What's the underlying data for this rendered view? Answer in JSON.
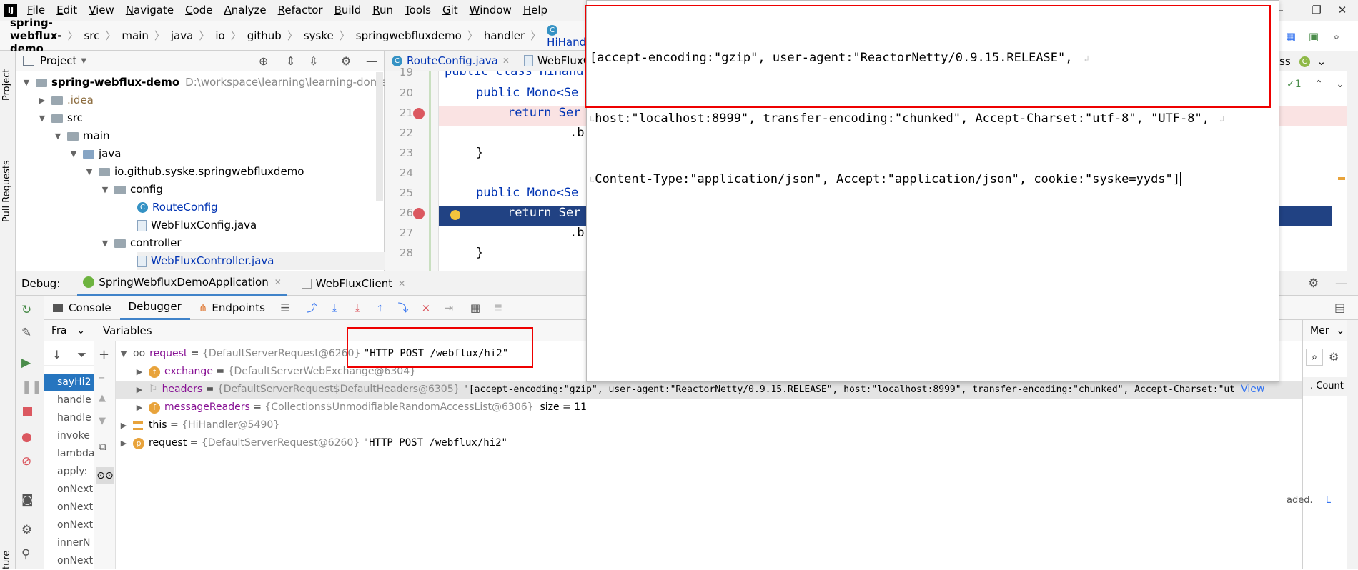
{
  "menu": [
    "File",
    "Edit",
    "View",
    "Navigate",
    "Code",
    "Analyze",
    "Refactor",
    "Build",
    "Run",
    "Tools",
    "Git",
    "Window",
    "Help"
  ],
  "breadcrumbs": [
    "spring-webflux-demo",
    "src",
    "main",
    "java",
    "io",
    "github",
    "syske",
    "springwebfluxdemo",
    "handler",
    "HiHandle"
  ],
  "left_strip": {
    "project": "Project",
    "pull_requests": "Pull Requests",
    "structure": "ture"
  },
  "project": {
    "title": "Project",
    "root_name": "spring-webflux-demo",
    "root_path": "D:\\workspace\\learning\\learning-dome-co",
    "items": [
      ".idea",
      "src",
      "main",
      "java",
      "io.github.syske.springwebfluxdemo",
      "config",
      "RouteConfig",
      "WebFluxConfig.java",
      "controller",
      "WebFluxController.java"
    ]
  },
  "editor": {
    "tabs": [
      "RouteConfig.java",
      "WebFluxC",
      "ss"
    ],
    "top_partial": "public class HiHand",
    "lines": [
      {
        "num": "20",
        "text": "public Mono<Se"
      },
      {
        "num": "21",
        "text": "return Ser"
      },
      {
        "num": "22",
        "text": ".b"
      },
      {
        "num": "23",
        "text": "}"
      },
      {
        "num": "24",
        "text": ""
      },
      {
        "num": "25",
        "text": "public Mono<Se"
      },
      {
        "num": "26",
        "text": "return Ser"
      },
      {
        "num": "27",
        "text": ".b"
      },
      {
        "num": "28",
        "text": "}"
      }
    ],
    "partial_19": "19",
    "inspect_count": "1"
  },
  "debug": {
    "label": "Debug:",
    "sessions": [
      "SpringWebfluxDemoApplication",
      "WebFluxClient"
    ],
    "tabs": [
      "Console",
      "Debugger",
      "Endpoints"
    ],
    "frames_label": "Fra",
    "variables_label": "Variables",
    "memory_label": "Mer",
    "count_label": ". Count",
    "loaded_text": "aded.",
    "loaded_link": "L",
    "frames": [
      "sayHi2",
      "handle",
      "handle",
      "invoke",
      "lambda",
      "apply:",
      "onNext",
      "onNext",
      "onNext",
      "innerN",
      "onNext"
    ]
  },
  "variables": {
    "request": {
      "name": "request",
      "type": "{DefaultServerRequest@6260}",
      "value": "\"HTTP POST /webflux/hi2\""
    },
    "exchange": {
      "name": "exchange",
      "type": "{DefaultServerWebExchange@6304}"
    },
    "headers": {
      "name": "headers",
      "type": "{DefaultServerRequest$DefaultHeaders@6305}",
      "value": "\"[accept-encoding:\"gzip\", user-agent:\"ReactorNetty/0.9.15.RELEASE\", host:\"localhost:8999\", transfer-encoding:\"chunked\", Accept-Charset:\"ut",
      "view": "View"
    },
    "messageReaders": {
      "name": "messageReaders",
      "type": "{Collections$UnmodifiableRandomAccessList@6306}",
      "size": "size = 11"
    },
    "this": {
      "name": "this",
      "type": "{HiHandler@5490}"
    },
    "request2": {
      "name": "request",
      "type": "{DefaultServerRequest@6260}",
      "value": "\"HTTP POST /webflux/hi2\""
    }
  },
  "popup": {
    "line1": "[accept-encoding:\"gzip\", user-agent:\"ReactorNetty/0.9.15.RELEASE\",",
    "line2": "host:\"localhost:8999\", transfer-encoding:\"chunked\", Accept-Charset:\"utf-8\", \"UTF-8\",",
    "line3": "Content-Type:\"application/json\", Accept:\"application/json\", cookie:\"syske=yyds\"]"
  }
}
